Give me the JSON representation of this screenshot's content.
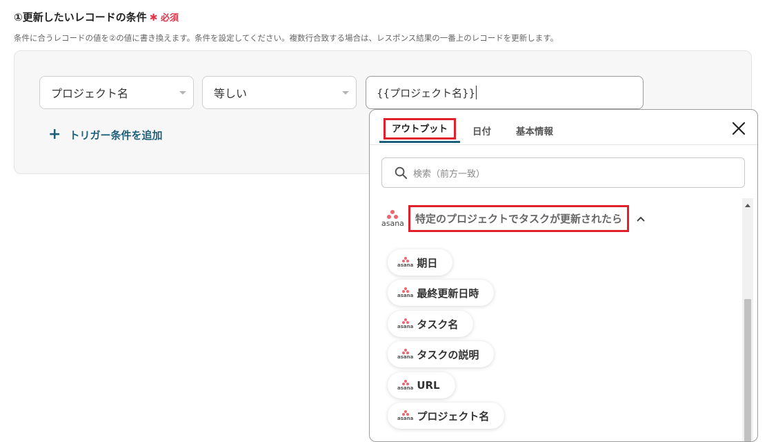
{
  "section": {
    "title": "①更新したいレコードの条件",
    "required_label": "必須",
    "description": "条件に合うレコードの値を②の値に書き換えます。条件を設定してください。複数行合致する場合は、レスポンス結果の一番上のレコードを更新します。"
  },
  "condition": {
    "field_value": "プロジェクト名",
    "operator_value": "等しい",
    "value_text": "{{プロジェクト名}}",
    "add_trigger_label": "トリガー条件を追加"
  },
  "dropdown": {
    "tabs": [
      {
        "label": "アウトプット",
        "active": true
      },
      {
        "label": "日付",
        "active": false
      },
      {
        "label": "基本情報",
        "active": false
      }
    ],
    "search_placeholder": "検索（前方一致）",
    "group": {
      "app_name": "asana",
      "title": "特定のプロジェクトでタスクが更新されたら"
    },
    "items": [
      {
        "label": "期日",
        "app": "asana"
      },
      {
        "label": "最終更新日時",
        "app": "asana"
      },
      {
        "label": "タスク名",
        "app": "asana"
      },
      {
        "label": "タスクの説明",
        "app": "asana"
      },
      {
        "label": "URL",
        "app": "asana"
      },
      {
        "label": "プロジェクト名",
        "app": "asana"
      }
    ]
  },
  "colors": {
    "accent": "#1f5f79",
    "required": "#e0364a",
    "highlight_box": "#e0202a",
    "asana_logo": "#f0646d"
  }
}
